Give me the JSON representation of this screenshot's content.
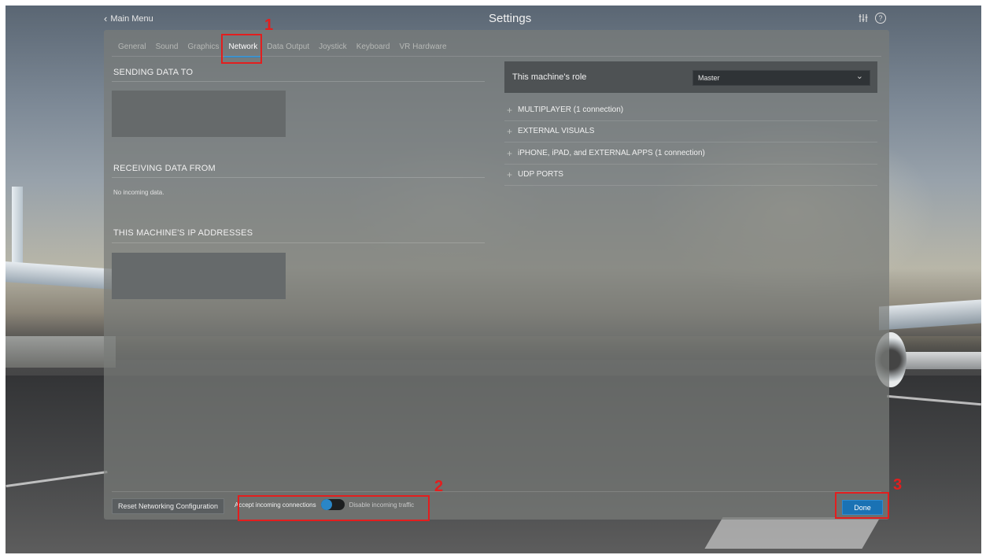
{
  "header": {
    "back_label": "Main Menu",
    "title": "Settings",
    "icons": [
      "sliders-icon",
      "help-icon"
    ]
  },
  "tabs": [
    {
      "label": "General",
      "active": false
    },
    {
      "label": "Sound",
      "active": false
    },
    {
      "label": "Graphics",
      "active": false
    },
    {
      "label": "Network",
      "active": true
    },
    {
      "label": "Data Output",
      "active": false
    },
    {
      "label": "Joystick",
      "active": false
    },
    {
      "label": "Keyboard",
      "active": false
    },
    {
      "label": "VR Hardware",
      "active": false
    }
  ],
  "left": {
    "sending_title": "SENDING DATA TO",
    "receiving_title": "RECEIVING DATA FROM",
    "receiving_text": "No incoming data.",
    "ip_title": "THIS MACHINE'S IP ADDRESSES"
  },
  "right": {
    "role_label": "This machine's role",
    "role_value": "Master",
    "sections": [
      "MULTIPLAYER (1 connection)",
      "EXTERNAL VISUALS",
      "iPHONE, iPAD, and EXTERNAL APPS (1 connection)",
      "UDP PORTS"
    ]
  },
  "footer": {
    "reset_label": "Reset Networking Configuration",
    "toggle_on_label": "Accept incoming connections",
    "toggle_off_label": "Disable incoming traffic",
    "toggle_state": "accept",
    "done_label": "Done"
  },
  "annotations": [
    "1",
    "2",
    "3"
  ],
  "colors": {
    "accent": "#2a86c7",
    "annotation": "#e31e1e",
    "done_button": "#1a72b4"
  }
}
